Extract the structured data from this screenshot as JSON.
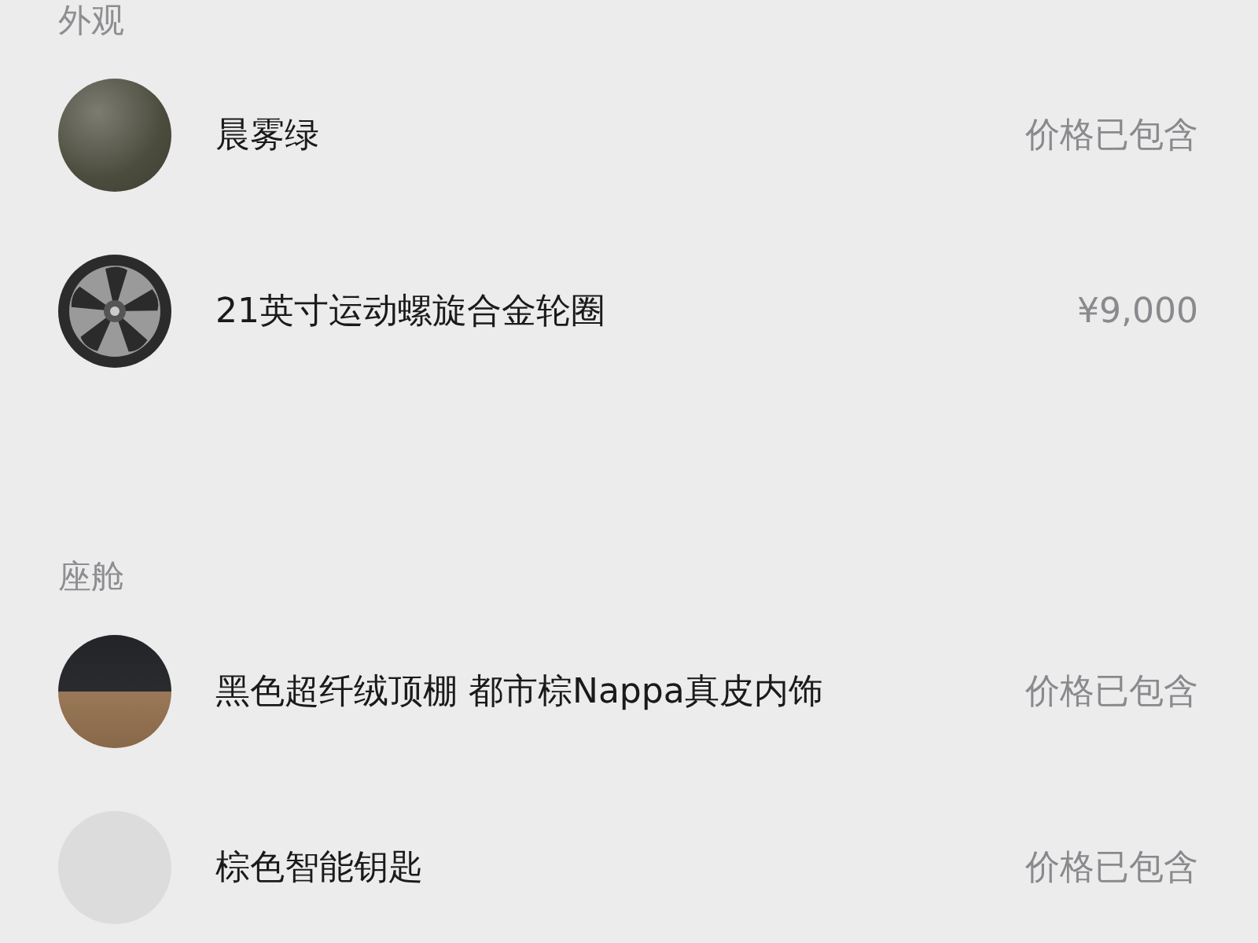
{
  "sections": [
    {
      "title": "外观",
      "items": [
        {
          "kind": "paint",
          "name": "晨雾绿",
          "price": "价格已包含"
        },
        {
          "kind": "wheel",
          "name": "21英寸运动螺旋合金轮圈",
          "price": "¥9,000"
        }
      ]
    },
    {
      "title": "座舱",
      "items": [
        {
          "kind": "interior",
          "name": "黑色超纤绒顶棚 都市棕Nappa真皮内饰",
          "price": "价格已包含"
        },
        {
          "kind": "key",
          "name": "棕色智能钥匙",
          "price": "价格已包含"
        }
      ]
    }
  ]
}
